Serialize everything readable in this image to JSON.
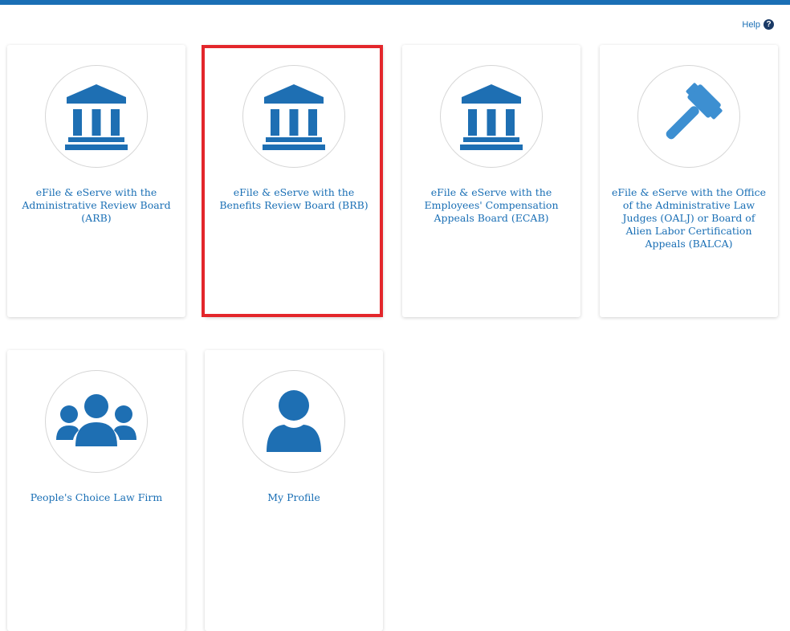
{
  "help": {
    "label": "Help"
  },
  "cards": [
    {
      "label": "eFile & eServe with the Administrative Review Board (ARB)",
      "icon": "courthouse-icon"
    },
    {
      "label": "eFile & eServe with the Benefits Review Board (BRB)",
      "icon": "courthouse-icon"
    },
    {
      "label": "eFile & eServe with the Employees' Compensation Appeals Board (ECAB)",
      "icon": "courthouse-icon"
    },
    {
      "label": "eFile & eServe with the Office of the Administrative Law Judges (OALJ) or Board of Alien Labor Certification Appeals (BALCA)",
      "icon": "gavel-icon"
    },
    {
      "label": "People's Choice Law Firm",
      "icon": "users-icon"
    },
    {
      "label": "My Profile",
      "icon": "user-icon"
    }
  ],
  "colors": {
    "accent": "#1a6fb5",
    "icon": "#1e6fb3",
    "highlight": "#e3262b"
  }
}
